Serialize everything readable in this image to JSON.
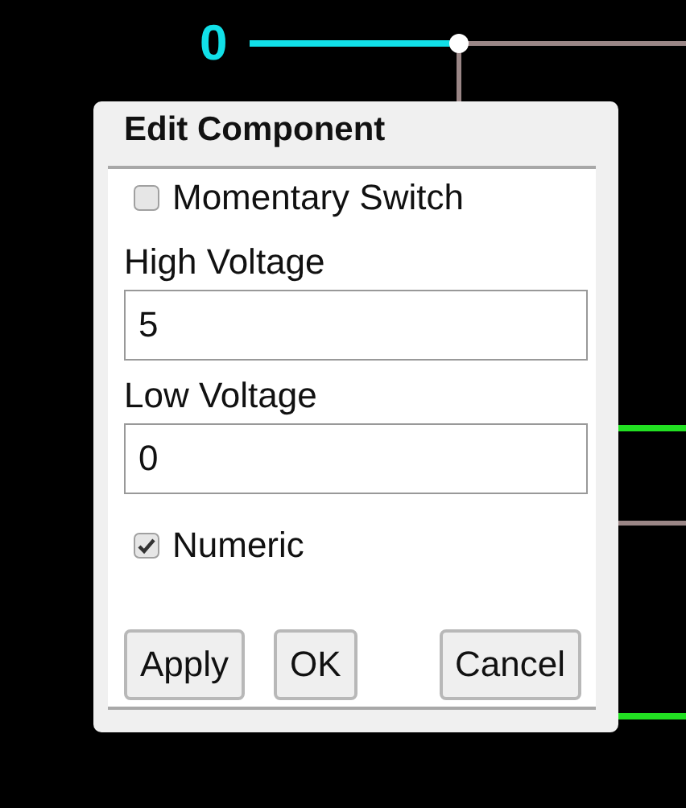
{
  "circuit": {
    "node_label": "0"
  },
  "dialog": {
    "title": "Edit Component",
    "items": [
      {
        "kind": "checkbox",
        "label": "Momentary Switch",
        "checked": false
      },
      {
        "kind": "text",
        "label": "High Voltage",
        "value": "5"
      },
      {
        "kind": "text",
        "label": "Low Voltage",
        "value": "0"
      },
      {
        "kind": "checkbox",
        "label": "Numeric",
        "checked": true
      }
    ],
    "buttons": [
      "Apply",
      "OK",
      "Cancel"
    ]
  }
}
